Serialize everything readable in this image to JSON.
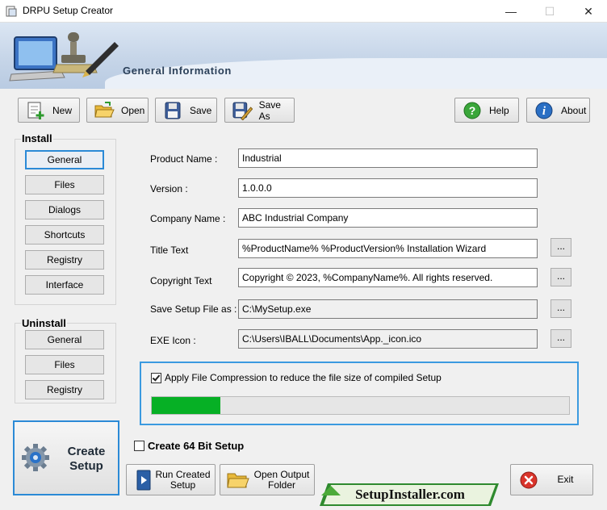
{
  "window": {
    "title": "DRPU Setup Creator",
    "minimize_glyph": "—",
    "maximize_glyph": "☐",
    "close_glyph": "✕"
  },
  "header": {
    "title": "General Information"
  },
  "toolbar": {
    "new": "New",
    "open": "Open",
    "save": "Save",
    "save_as": "Save As",
    "help": "Help",
    "about": "About"
  },
  "install": {
    "title": "Install",
    "items": [
      "General",
      "Files",
      "Dialogs",
      "Shortcuts",
      "Registry",
      "Interface"
    ]
  },
  "uninstall": {
    "title": "Uninstall",
    "items": [
      "General",
      "Files",
      "Registry"
    ]
  },
  "form": {
    "product_name": {
      "label": "Product Name :",
      "value": "Industrial"
    },
    "version": {
      "label": "Version :",
      "value": "1.0.0.0"
    },
    "company_name": {
      "label": "Company Name :",
      "value": "ABC Industrial Company"
    },
    "title_text": {
      "label": "Title Text",
      "value": "%ProductName% %ProductVersion% Installation Wizard"
    },
    "copyright_text": {
      "label": "Copyright Text",
      "value": "Copyright © 2023, %CompanyName%. All rights reserved."
    },
    "save_setup": {
      "label": "Save Setup File as :",
      "value": "C:\\MySetup.exe"
    },
    "exe_icon": {
      "label": "EXE Icon :",
      "value": "C:\\Users\\IBALL\\Documents\\App._icon.ico"
    },
    "browse_label": "..."
  },
  "compression": {
    "label": "Apply File Compression to reduce the file size of compiled Setup",
    "checked": true,
    "progress_fraction": 0.165
  },
  "create_64bit": {
    "label": "Create 64 Bit Setup",
    "checked": false
  },
  "buttons": {
    "create_line1": "Create",
    "create_line2": "Setup",
    "run_line1": "Run Created",
    "run_line2": "Setup",
    "open_line1": "Open Output",
    "open_line2": "Folder",
    "exit": "Exit"
  },
  "brand": "SetupInstaller.com",
  "colors": {
    "accent_blue": "#2b8ad6",
    "progress_green": "#06b025",
    "brand_green": "#2f8a2f",
    "exit_red": "#d9342b"
  }
}
